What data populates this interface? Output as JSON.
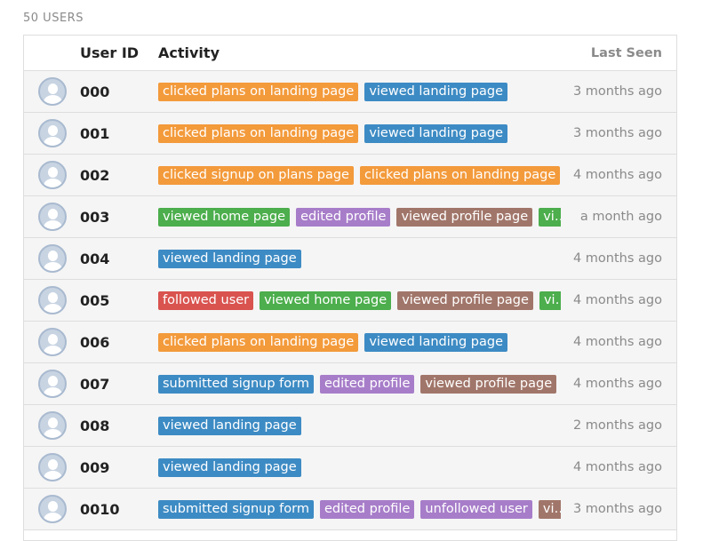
{
  "header": {
    "user_count": "50 USERS"
  },
  "columns": {
    "user_id": "User ID",
    "activity": "Activity",
    "last_seen": "Last Seen"
  },
  "colors": {
    "orange": "#f39a3b",
    "blue": "#3d8bc4",
    "green": "#4cae4c",
    "purple": "#a77dc9",
    "brown": "#a1766a",
    "red": "#d9534f"
  },
  "rows": [
    {
      "id": "000",
      "last_seen": "3 months ago",
      "tags": [
        {
          "text": "clicked plans on landing page",
          "color": "orange"
        },
        {
          "text": "viewed landing page",
          "color": "blue"
        }
      ]
    },
    {
      "id": "001",
      "last_seen": "3 months ago",
      "tags": [
        {
          "text": "clicked plans on landing page",
          "color": "orange"
        },
        {
          "text": "viewed landing page",
          "color": "blue"
        }
      ]
    },
    {
      "id": "002",
      "last_seen": "4 months ago",
      "tags": [
        {
          "text": "clicked signup on plans page",
          "color": "orange"
        },
        {
          "text": "clicked plans on landing page",
          "color": "orange"
        },
        {
          "text": "...",
          "color": "blue",
          "truncated": true
        }
      ]
    },
    {
      "id": "003",
      "last_seen": "a month ago",
      "tags": [
        {
          "text": "viewed home page",
          "color": "green"
        },
        {
          "text": "edited profile",
          "color": "purple"
        },
        {
          "text": "viewed profile page",
          "color": "brown"
        },
        {
          "text": "vie...",
          "color": "green",
          "truncated": true
        }
      ]
    },
    {
      "id": "004",
      "last_seen": "4 months ago",
      "tags": [
        {
          "text": "viewed landing page",
          "color": "blue"
        }
      ]
    },
    {
      "id": "005",
      "last_seen": "4 months ago",
      "tags": [
        {
          "text": "followed user",
          "color": "red"
        },
        {
          "text": "viewed home page",
          "color": "green"
        },
        {
          "text": "viewed profile page",
          "color": "brown"
        },
        {
          "text": "vie...",
          "color": "green",
          "truncated": true
        }
      ]
    },
    {
      "id": "006",
      "last_seen": "4 months ago",
      "tags": [
        {
          "text": "clicked plans on landing page",
          "color": "orange"
        },
        {
          "text": "viewed landing page",
          "color": "blue"
        }
      ]
    },
    {
      "id": "007",
      "last_seen": "4 months ago",
      "tags": [
        {
          "text": "submitted signup form",
          "color": "blue"
        },
        {
          "text": "edited profile",
          "color": "purple"
        },
        {
          "text": "viewed profile page",
          "color": "brown"
        },
        {
          "text": "...",
          "color": "green",
          "truncated": true
        }
      ]
    },
    {
      "id": "008",
      "last_seen": "2 months ago",
      "tags": [
        {
          "text": "viewed landing page",
          "color": "blue"
        }
      ]
    },
    {
      "id": "009",
      "last_seen": "4 months ago",
      "tags": [
        {
          "text": "viewed landing page",
          "color": "blue"
        }
      ]
    },
    {
      "id": "0010",
      "last_seen": "3 months ago",
      "tags": [
        {
          "text": "submitted signup form",
          "color": "blue"
        },
        {
          "text": "edited profile",
          "color": "purple"
        },
        {
          "text": "unfollowed user",
          "color": "purple"
        },
        {
          "text": "vie...",
          "color": "brown",
          "truncated": true
        }
      ]
    }
  ]
}
